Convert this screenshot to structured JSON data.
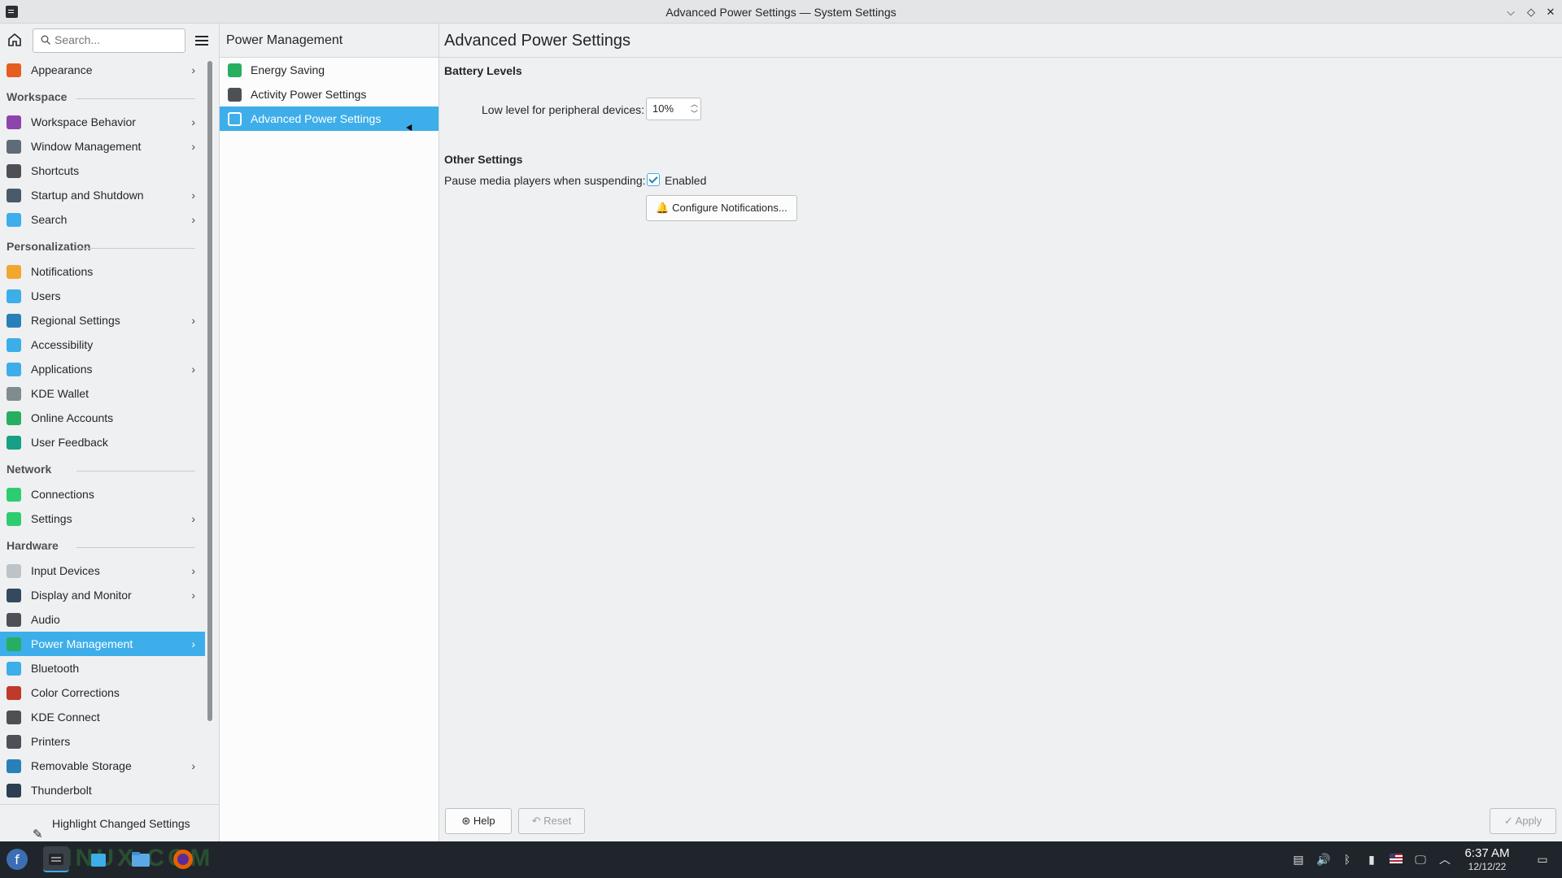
{
  "window": {
    "title": "Advanced Power Settings — System Settings",
    "minimize_glyph": "⌵",
    "maximize_glyph": "◇",
    "close_glyph": "✕"
  },
  "sidebar": {
    "search_placeholder": "Search...",
    "items": [
      {
        "type": "item",
        "label": "Appearance",
        "chevron": true,
        "icon": "appearance-icon",
        "color": "#e55d1f"
      },
      {
        "type": "section",
        "label": "Workspace"
      },
      {
        "type": "item",
        "label": "Workspace Behavior",
        "chevron": true,
        "icon": "workspace-behavior-icon",
        "color": "#8e44ad"
      },
      {
        "type": "item",
        "label": "Window Management",
        "chevron": true,
        "icon": "window-management-icon",
        "color": "#5f6b77"
      },
      {
        "type": "item",
        "label": "Shortcuts",
        "chevron": false,
        "icon": "keyboard-icon",
        "color": "#4d5055"
      },
      {
        "type": "item",
        "label": "Startup and Shutdown",
        "chevron": true,
        "icon": "startup-icon",
        "color": "#4a5a6a"
      },
      {
        "type": "item",
        "label": "Search",
        "chevron": true,
        "icon": "search-icon",
        "color": "#3daee9"
      },
      {
        "type": "section",
        "label": "Personalization"
      },
      {
        "type": "item",
        "label": "Notifications",
        "chevron": false,
        "icon": "bell-icon",
        "color": "#f0a830"
      },
      {
        "type": "item",
        "label": "Users",
        "chevron": false,
        "icon": "users-icon",
        "color": "#3daee9"
      },
      {
        "type": "item",
        "label": "Regional Settings",
        "chevron": true,
        "icon": "regional-icon",
        "color": "#2980b9"
      },
      {
        "type": "item",
        "label": "Accessibility",
        "chevron": false,
        "icon": "accessibility-icon",
        "color": "#3daee9"
      },
      {
        "type": "item",
        "label": "Applications",
        "chevron": true,
        "icon": "applications-icon",
        "color": "#3daee9"
      },
      {
        "type": "item",
        "label": "KDE Wallet",
        "chevron": false,
        "icon": "wallet-icon",
        "color": "#7f8c8d"
      },
      {
        "type": "item",
        "label": "Online Accounts",
        "chevron": false,
        "icon": "online-accounts-icon",
        "color": "#27ae60"
      },
      {
        "type": "item",
        "label": "User Feedback",
        "chevron": false,
        "icon": "feedback-icon",
        "color": "#16a085"
      },
      {
        "type": "section",
        "label": "Network"
      },
      {
        "type": "item",
        "label": "Connections",
        "chevron": false,
        "icon": "connections-icon",
        "color": "#2ecc71"
      },
      {
        "type": "item",
        "label": "Settings",
        "chevron": true,
        "icon": "network-settings-icon",
        "color": "#2ecc71"
      },
      {
        "type": "section",
        "label": "Hardware"
      },
      {
        "type": "item",
        "label": "Input Devices",
        "chevron": true,
        "icon": "mouse-icon",
        "color": "#bdc3c7"
      },
      {
        "type": "item",
        "label": "Display and Monitor",
        "chevron": true,
        "icon": "monitor-icon",
        "color": "#34495e"
      },
      {
        "type": "item",
        "label": "Audio",
        "chevron": false,
        "icon": "speaker-icon",
        "color": "#4d5055"
      },
      {
        "type": "item",
        "label": "Power Management",
        "chevron": true,
        "icon": "power-icon",
        "color": "#27ae60",
        "active": true
      },
      {
        "type": "item",
        "label": "Bluetooth",
        "chevron": false,
        "icon": "bluetooth-icon",
        "color": "#3daee9"
      },
      {
        "type": "item",
        "label": "Color Corrections",
        "chevron": false,
        "icon": "color-icon",
        "color": "#c0392b"
      },
      {
        "type": "item",
        "label": "KDE Connect",
        "chevron": false,
        "icon": "phone-icon",
        "color": "#4d5055"
      },
      {
        "type": "item",
        "label": "Printers",
        "chevron": false,
        "icon": "printer-icon",
        "color": "#4d5055"
      },
      {
        "type": "item",
        "label": "Removable Storage",
        "chevron": true,
        "icon": "usb-icon",
        "color": "#2980b9"
      },
      {
        "type": "item",
        "label": "Thunderbolt",
        "chevron": false,
        "icon": "thunderbolt-icon",
        "color": "#2c3e50"
      }
    ],
    "highlight_label": "Highlight Changed Settings"
  },
  "midpane": {
    "title": "Power Management",
    "items": [
      {
        "label": "Energy Saving",
        "icon": "energy-saving-icon",
        "color": "#27ae60"
      },
      {
        "label": "Activity Power Settings",
        "icon": "activity-icon",
        "color": "#4d5055"
      },
      {
        "label": "Advanced Power Settings",
        "icon": "list-icon",
        "color": "#ffffff",
        "active": true
      }
    ]
  },
  "content": {
    "title": "Advanced Power Settings",
    "battery_section": "Battery Levels",
    "peripheral_label": "Low level for peripheral devices:",
    "peripheral_value": "10%",
    "other_section": "Other Settings",
    "pause_label": "Pause media players when suspending:",
    "pause_checkbox_label": "Enabled",
    "pause_checked": true,
    "configure_notifications": "Configure Notifications...",
    "help": "Help",
    "reset": "Reset",
    "apply": "Apply"
  },
  "taskbar": {
    "time": "6:37 AM",
    "date": "12/12/22",
    "watermark": "LINUX  COM"
  },
  "colors": {
    "accent": "#3daee9",
    "taskbar": "#20252b"
  }
}
